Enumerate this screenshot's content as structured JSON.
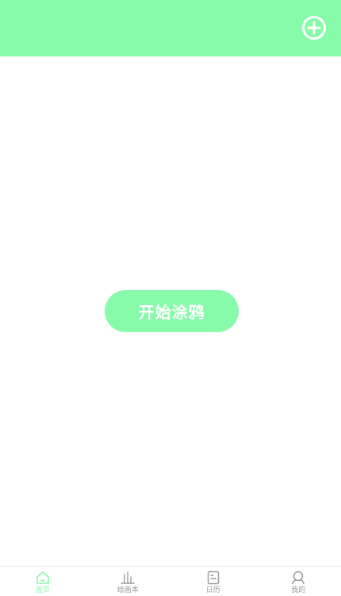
{
  "header": {
    "add_icon": "plus-circle-icon",
    "background_color": "#87fba9"
  },
  "main": {
    "start_button_label": "开始涂鸦",
    "accent_color": "#87fba9"
  },
  "tabbar": {
    "active_color": "#87fba9",
    "inactive_color": "#9a9a9a",
    "items": [
      {
        "label": "首页",
        "icon": "home-icon",
        "active": true
      },
      {
        "label": "绘画本",
        "icon": "bar-chart-icon",
        "active": false
      },
      {
        "label": "日历",
        "icon": "document-icon",
        "active": false
      },
      {
        "label": "我的",
        "icon": "user-icon",
        "active": false
      }
    ]
  }
}
